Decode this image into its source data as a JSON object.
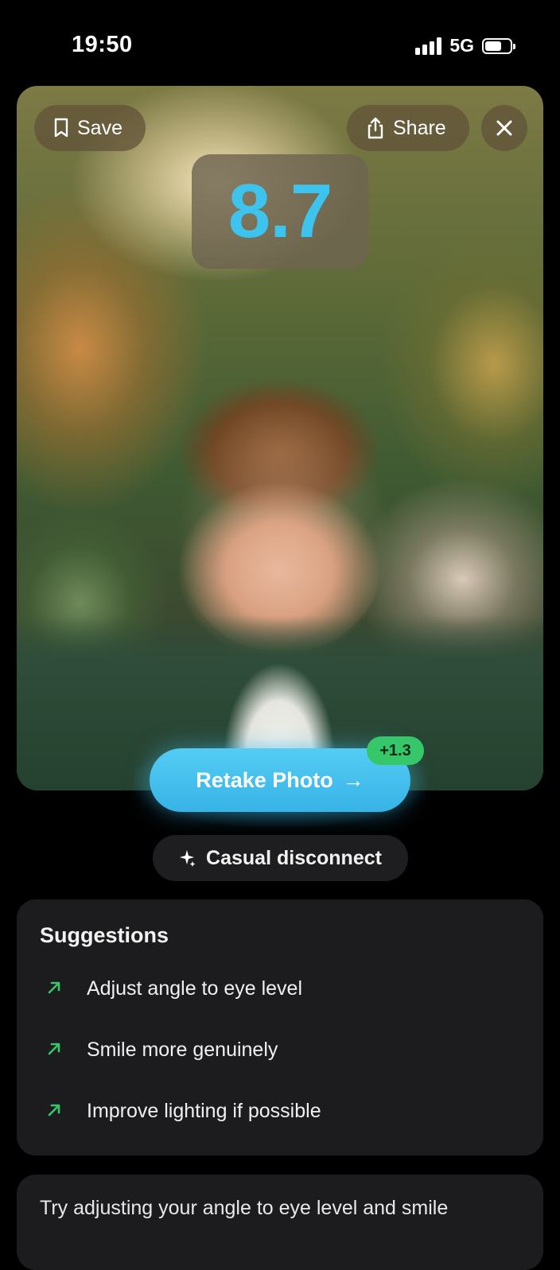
{
  "status_bar": {
    "time": "19:50",
    "network": "5G"
  },
  "photo": {
    "save_label": "Save",
    "share_label": "Share",
    "score": "8.7"
  },
  "retake": {
    "label": "Retake Photo",
    "arrow": "→",
    "boost": "+1.3"
  },
  "tag": {
    "icon": "sparkle-icon",
    "label": "Casual disconnect"
  },
  "suggestions": {
    "title": "Suggestions",
    "items": [
      {
        "label": "Adjust angle to eye level"
      },
      {
        "label": "Smile more genuinely"
      },
      {
        "label": "Improve lighting if possible"
      }
    ]
  },
  "summary": {
    "text": "Try adjusting your angle to eye level and smile"
  },
  "colors": {
    "score_blue": "#3cc4ef",
    "retake_blue": "#44bfee",
    "boost_green": "#35c76a",
    "card_bg": "#1c1c1e"
  }
}
